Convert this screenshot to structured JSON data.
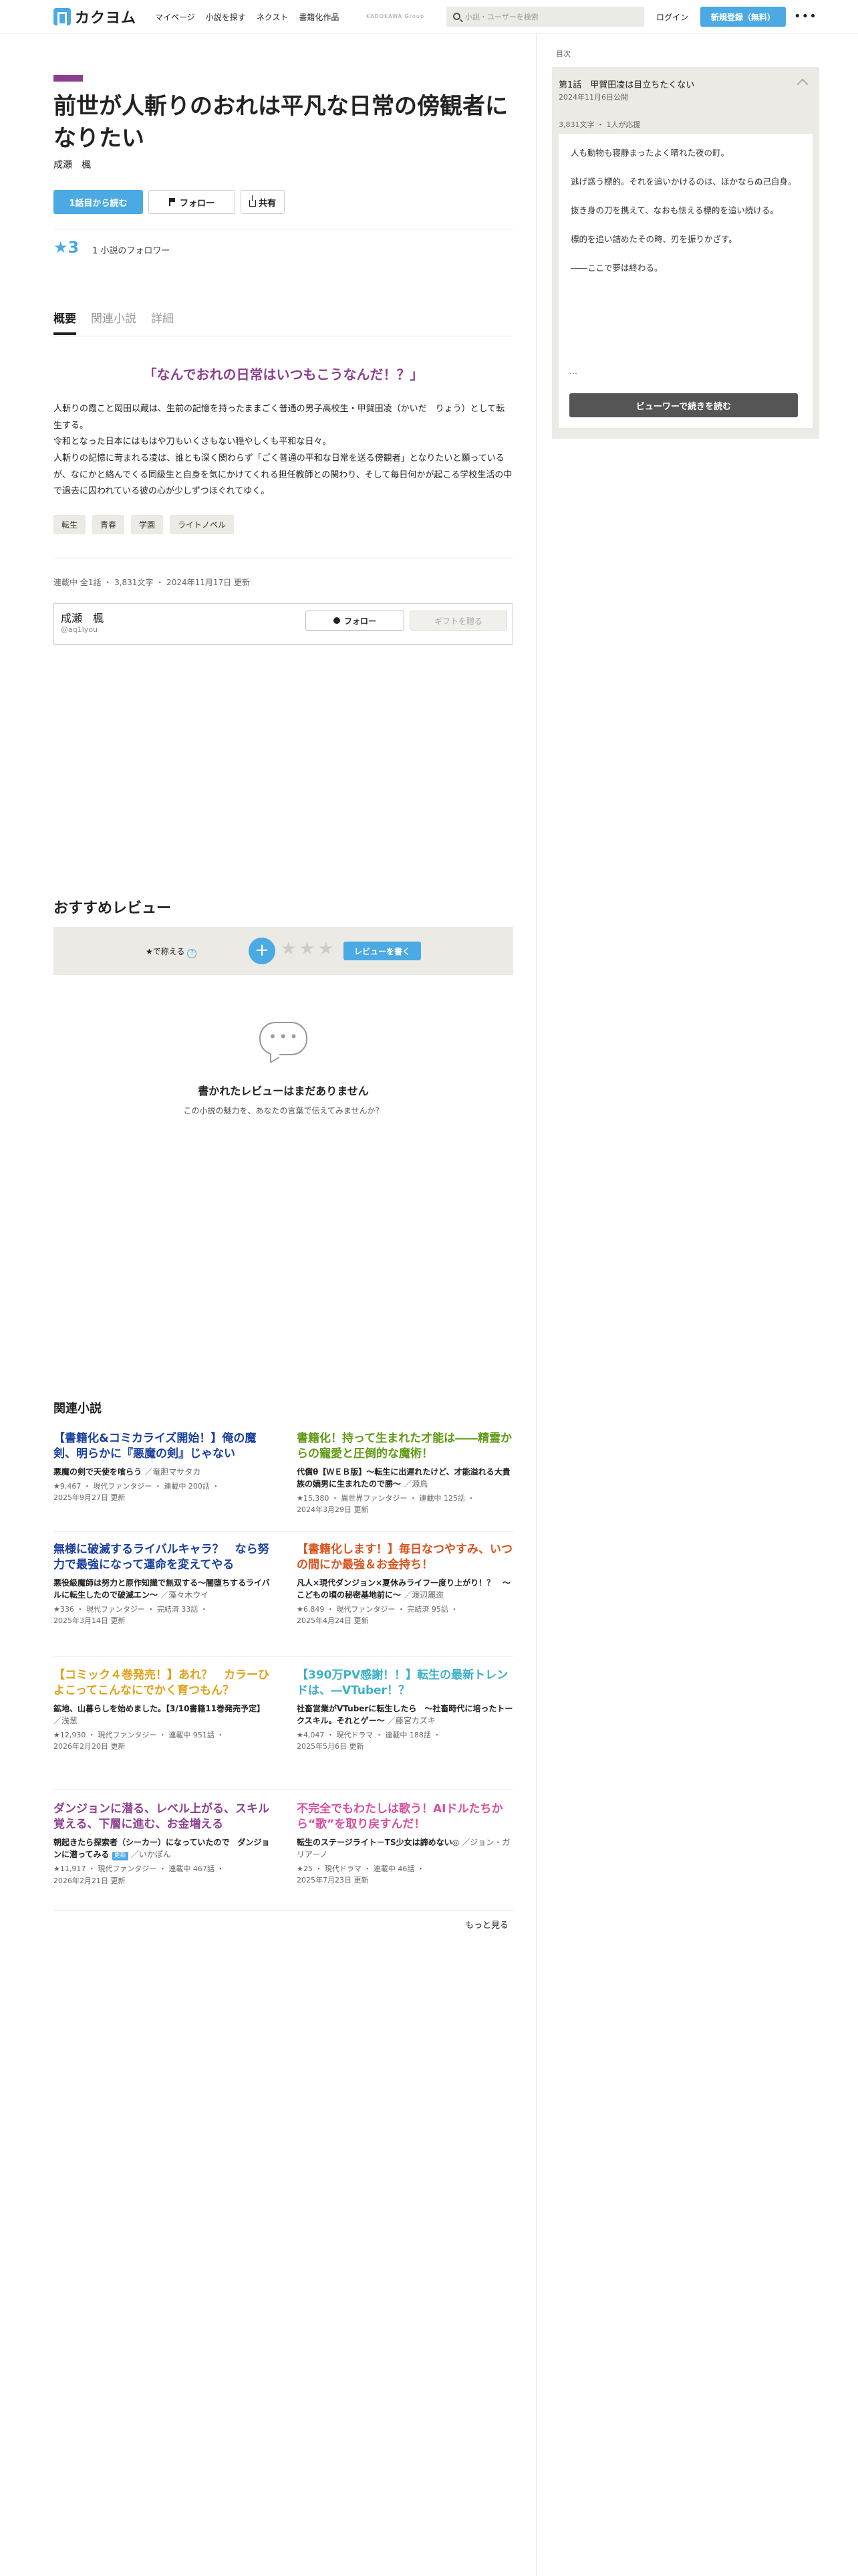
{
  "header": {
    "logo_text": "カクヨム",
    "nav": [
      "マイページ",
      "小説を探す",
      "ネクスト",
      "書籍化作品"
    ],
    "group": "KADOKAWA Group",
    "search_placeholder": "小説・ユーザーを検索",
    "login": "ログイン",
    "signup": "新規登録（無料）",
    "more": "•••"
  },
  "work": {
    "title": "前世が人斬りのおれは平凡な日常の傍観者になりたい",
    "author": "成瀬　楓",
    "read_button": "1話目から読む",
    "follow_button": "フォロー",
    "share_button": "共有",
    "stars": "★3",
    "followers": "1 小説のフォロワー",
    "tabs": [
      "概要",
      "関連小説",
      "詳細"
    ],
    "catchphrase": "「なんでおれの日常はいつもこうなんだ！？」",
    "intro": [
      "人斬りの霞こと岡田以蔵は、生前の記憶を持ったままごく普通の男子高校生・甲賀田凌（かいだ　りょう）として転生する。",
      "令和となった日本にはもはや刀もいくさもない穏やしくも平和な日々。",
      "人斬りの記憶に苛まれる凌は、誰とも深く関わらず「ごく普通の平和な日常を送る傍観者」となりたいと願っているが、なにかと絡んでくる同級生と自身を気にかけてくれる担任教師との関わり、そして毎日何かが起こる学校生活の中で過去に囚われている彼の心が少しずつほぐれてゆく。"
    ],
    "tags": [
      "転生",
      "青春",
      "学園",
      "ライトノベル"
    ],
    "meta": "連載中 全1話 ・ 3,831文字 ・ 2024年11月17日 更新",
    "author_card": {
      "name": "成瀬　楓",
      "id": "@aq1lyou",
      "follow": "フォロー",
      "gift": "ギフトを贈る"
    }
  },
  "sidebar": {
    "toc_label": "目次",
    "episode_title": "第1話　甲賀田凌は目立ちたくない",
    "episode_date": "2024年11月6日公開",
    "episode_meta": "3,831文字 ・ 1人が応援",
    "preview": [
      "人も動物も寝静まったよく晴れた夜の町。",
      "逃げ惑う標的。それを追いかけるのは、ほかならぬ己自身。",
      "抜き身の刀を携えて、なおも怯える標的を追い続ける。",
      "標的を追い詰めたその時、刃を振りかざす。",
      "――ここで夢は終わる。"
    ],
    "preview_ellipsis": "…",
    "viewer_button": "ビューワーで続きを読む"
  },
  "reviews": {
    "heading": "おすすめレビュー",
    "star_label": "★で称える",
    "help": "?",
    "plus": "+",
    "star": "★",
    "write_button": "レビューを書く",
    "empty_dots": "•••",
    "empty_title": "書かれたレビューはまだありません",
    "empty_sub": "この小説の魅力を、あなたの言葉で伝えてみませんか？"
  },
  "related": {
    "heading": "関連小説",
    "more": "もっと見る",
    "items": [
      {
        "title": "【書籍化&コミカライズ開始！】俺の魔剣、明らかに『悪魔の剣』じゃない",
        "color": "#1a3fa0",
        "work": "悪魔の剣で天使を喰らう",
        "author": "／竜胆マサタカ",
        "meta1": "★9,467 ・ 現代ファンタジー ・ 連載中 200話 ・",
        "meta2": "2025年9月27日 更新",
        "badge": ""
      },
      {
        "title": "書籍化！持って生まれた才能は――精霊からの寵愛と圧倒的な魔術！",
        "color": "#5f9a14",
        "work": "代償θ【ＷＥＢ版】～転生に出遅れたけど、才能溢れる大貴族の嫡男に生まれたので勝～",
        "author": "／源鳥",
        "meta1": "★15,380 ・ 異世界ファンタジー ・ 連載中 125話 ・",
        "meta2": "2024年3月29日 更新",
        "badge": ""
      },
      {
        "title": "無様に破滅するライバルキャラ？　なら努力で最強になって運命を変えてやる",
        "color": "#1a3fa0",
        "work": "悪役級魔師は努力と原作知識で無双する～闇堕ちするライバルに転生したので破滅エン～",
        "author": "／藻々木ウイ",
        "meta1": "★336 ・ 現代ファンタジー ・ 完結済 33話 ・",
        "meta2": "2025年3月14日 更新",
        "badge": ""
      },
      {
        "title": "【書籍化します！】毎日なつやすみ、いつの間にか最強＆お金持ち！",
        "color": "#d9541e",
        "work": "凡人×現代ダンジョン×夏休みライフ一度り上がり！？　～こどもの頃の秘密基地前に～",
        "author": "／渡辺麗迩",
        "meta1": "★6,849 ・ 現代ファンタジー ・ 完結済 95話 ・",
        "meta2": "2025年4月24日 更新",
        "badge": ""
      },
      {
        "title": "【コミック４巻発売！】あれ？　カラーひよこってこんなにでかく育つもん？",
        "color": "#e0a21a",
        "work": "鉱地、山暮らしを始めました。【3/10書籍11巻発売予定】",
        "author": "／浅葱",
        "meta1": "★12,930 ・ 現代ファンタジー ・ 連載中 951話 ・",
        "meta2": "2026年2月20日 更新",
        "badge": ""
      },
      {
        "title": "【390万PV感謝！！】転生の最新トレンドは、―VTuber！？",
        "color": "#3cb0c9",
        "work": "社畜営業がVTuberに転生したら　～社畜時代に培ったトークスキル。それとゲー～",
        "author": "／藤宮カズキ",
        "meta1": "★4,047 ・ 現代ドラマ ・ 連載中 188話 ・",
        "meta2": "2025年5月6日 更新",
        "badge": ""
      },
      {
        "title": "ダンジョンに潜る、レベル上がる、スキル覚える、下層に進む、お金増える",
        "color": "#8c3f8f",
        "work": "朝起きたら探索者（シーカー）になっていたので　ダンジョンに潜ってみる",
        "author": "／いかぽん",
        "meta1": "★11,917 ・ 現代ファンタジー ・ 連載中 467話 ・",
        "meta2": "2026年2月21日 更新",
        "badge": "更新"
      },
      {
        "title": "不完全でもわたしは歌う！AIドルたちから“歌”を取り戻すんだ！",
        "color": "#d64fa0",
        "work": "転生のステージライト－TS少女は諦めない◎",
        "author": "／ジョン・ガリアーノ",
        "meta1": "★25 ・ 現代ドラマ ・ 連載中 46話 ・",
        "meta2": "2025年7月23日 更新",
        "badge": ""
      }
    ]
  }
}
